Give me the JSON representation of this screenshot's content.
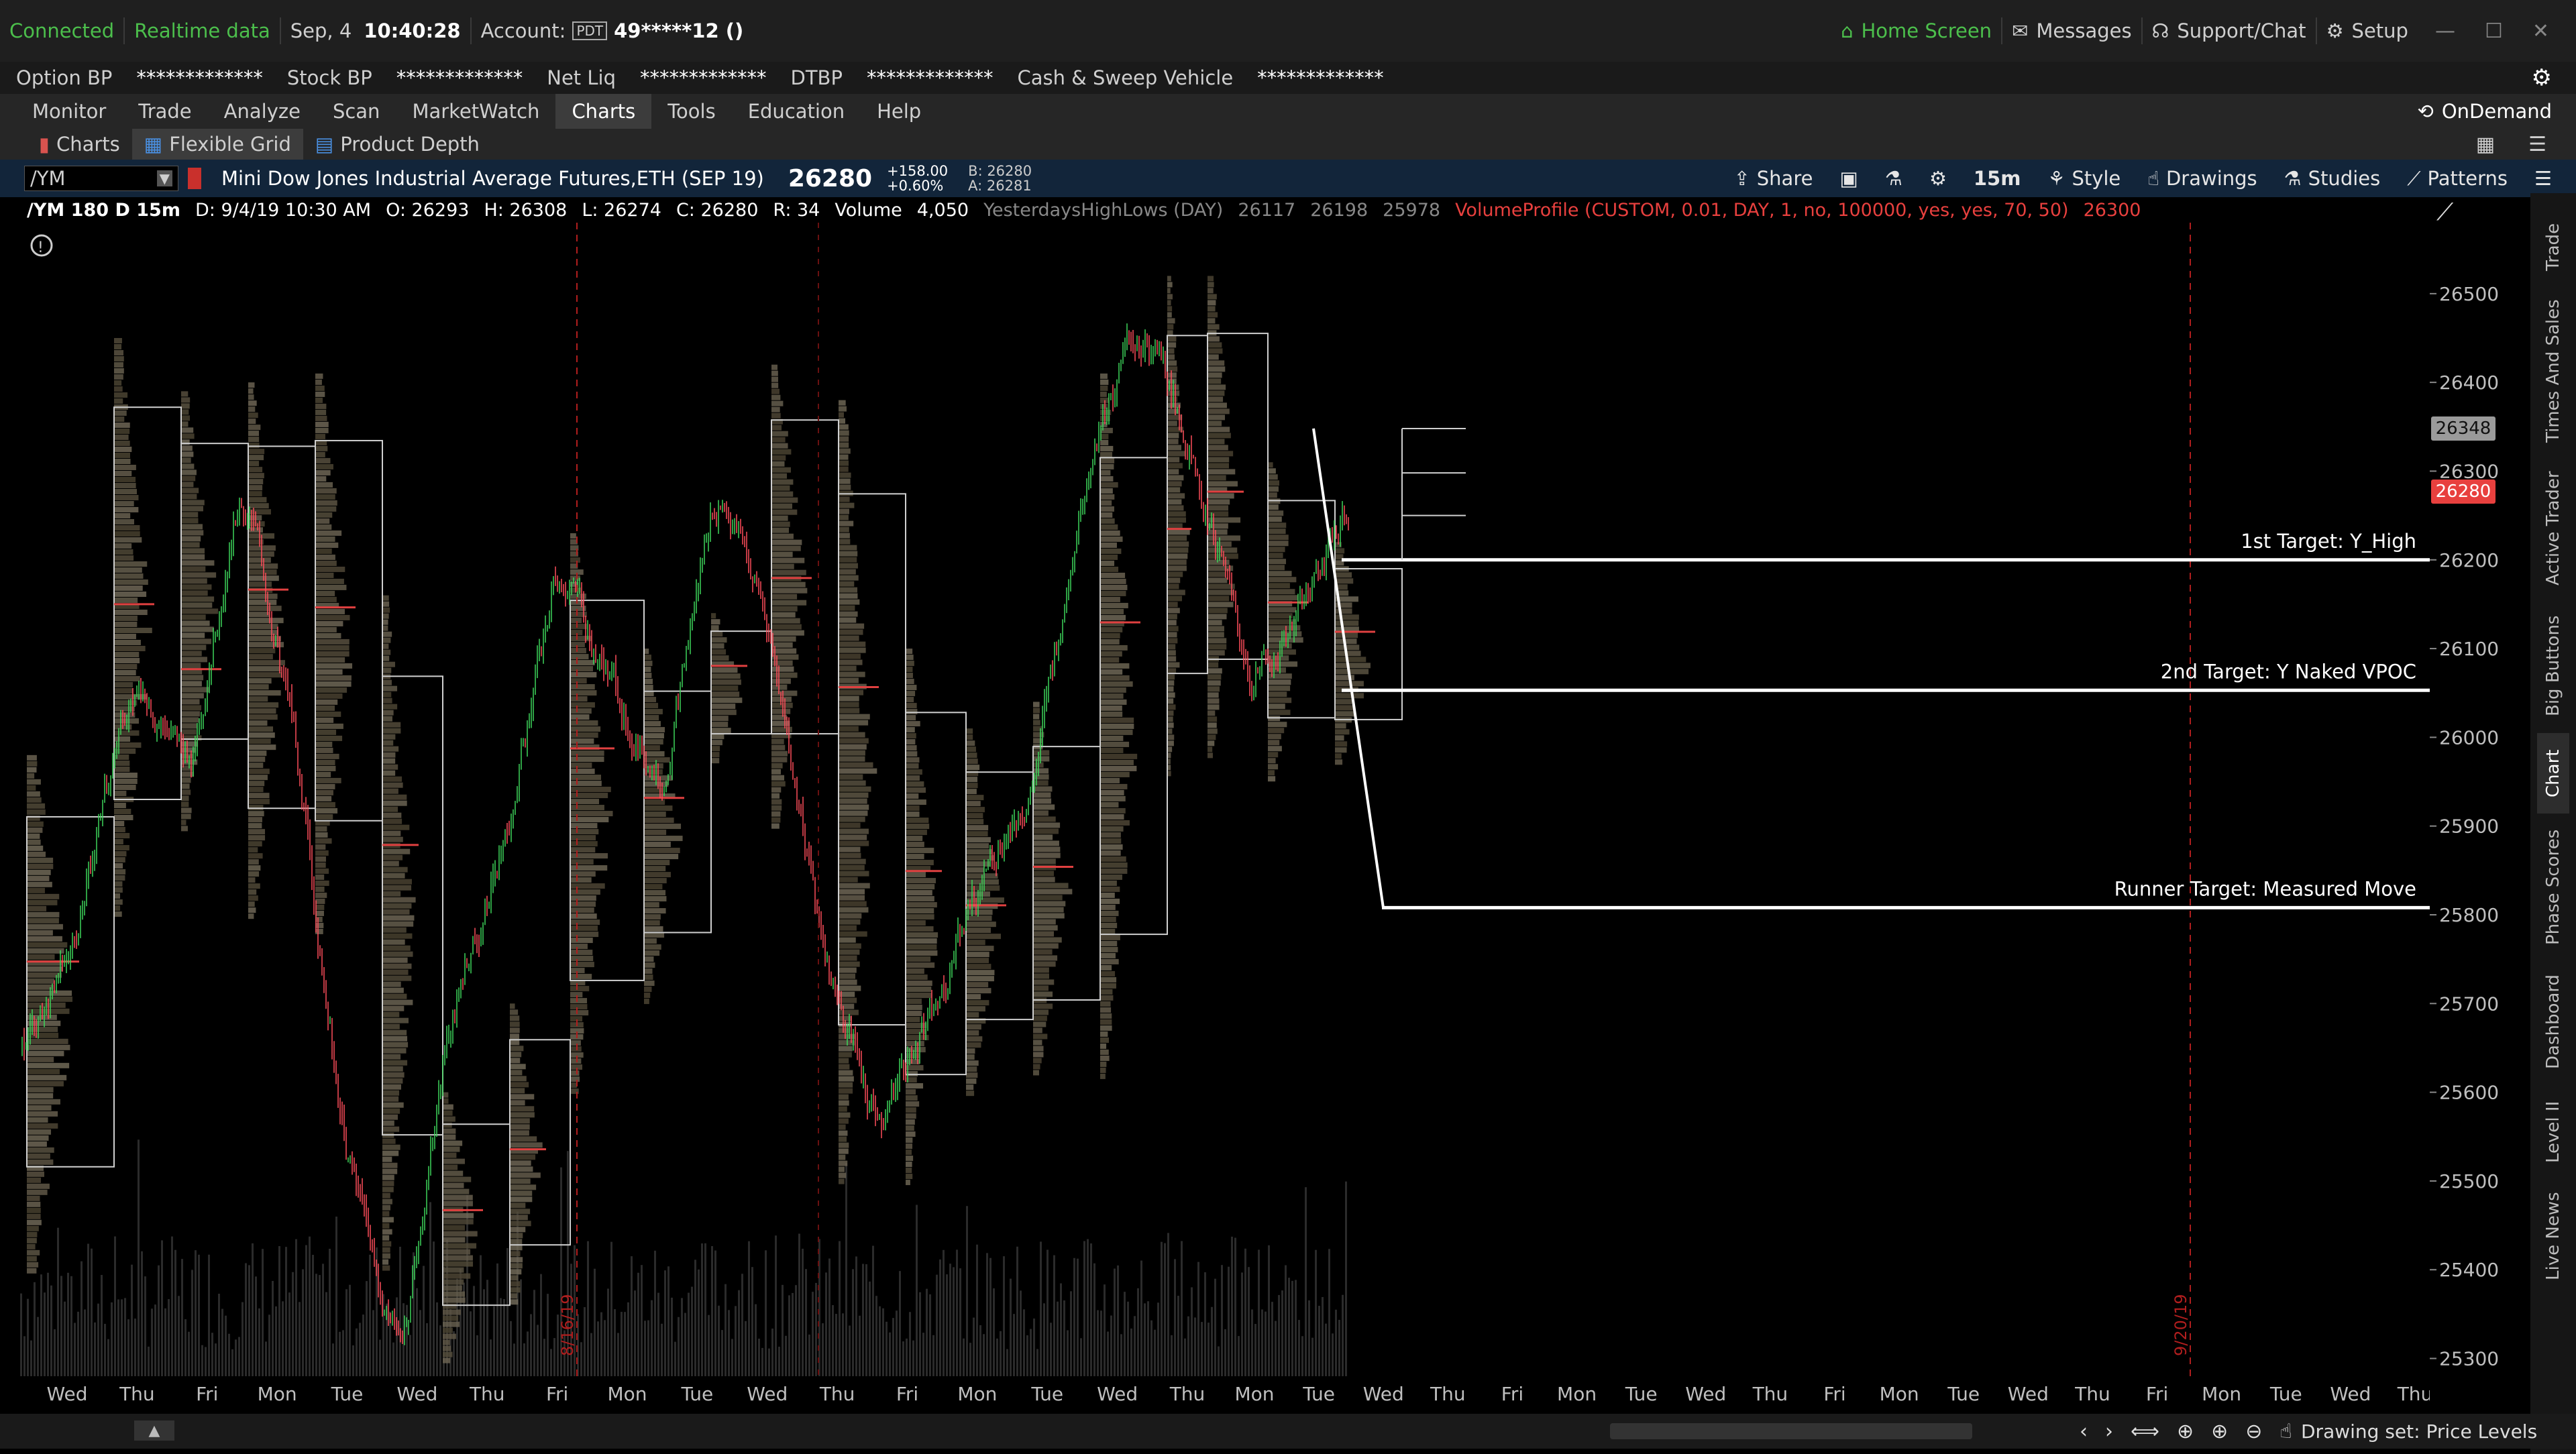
{
  "status": {
    "connected": "Connected",
    "realtime": "Realtime data",
    "date": "Sep, 4",
    "time": "10:40:28",
    "account_label": "Account:",
    "account_badge": "PDT",
    "account_id": "49*****12 ()",
    "home": "Home Screen",
    "messages": "Messages",
    "support": "Support/Chat",
    "setup": "Setup"
  },
  "balances": [
    {
      "label": "Option BP",
      "value": "*************"
    },
    {
      "label": "Stock BP",
      "value": "*************"
    },
    {
      "label": "Net Liq",
      "value": "*************"
    },
    {
      "label": "DTBP",
      "value": "*************"
    },
    {
      "label": "Cash & Sweep Vehicle",
      "value": "*************"
    }
  ],
  "menu": {
    "tabs": [
      "Monitor",
      "Trade",
      "Analyze",
      "Scan",
      "MarketWatch",
      "Charts",
      "Tools",
      "Education",
      "Help"
    ],
    "active": "Charts",
    "ondemand": "OnDemand"
  },
  "subtabs": [
    "Charts",
    "Flexible Grid",
    "Product Depth"
  ],
  "chart_header": {
    "symbol": "/YM",
    "description": "Mini Dow Jones Industrial Average Futures,ETH (SEP 19)",
    "last": "26280",
    "change": "+158.00",
    "change_pct": "+0.60%",
    "bid": "B: 26280",
    "ask": "A: 26281",
    "share": "Share",
    "timeframe": "15m",
    "style": "Style",
    "drawings": "Drawings",
    "studies": "Studies",
    "patterns": "Patterns"
  },
  "study_bar": {
    "period": "/YM 180 D 15m",
    "d": "D: 9/4/19 10:30 AM",
    "o": "O: 26293",
    "h": "H: 26308",
    "l": "L: 26274",
    "c": "C: 26280",
    "r": "R: 34",
    "vol_label": "Volume",
    "vol_value": "4,050",
    "yhl": "YesterdaysHighLows (DAY)",
    "yhl_values": [
      "26117",
      "26198",
      "25978"
    ],
    "vp": "VolumeProfile (CUSTOM, 0.01, DAY, 1, no, 100000, yes, yes, 70, 50)",
    "vp_value": "26300"
  },
  "chart_data": {
    "type": "candlestick",
    "y_ticks": [
      25300,
      25400,
      25500,
      25600,
      25700,
      25800,
      25900,
      26000,
      26100,
      26200,
      26300,
      26400,
      26500
    ],
    "ylim": [
      25280,
      26580
    ],
    "x_ticks": [
      "Wed",
      "Thu",
      "Fri",
      "Mon",
      "Tue",
      "Wed",
      "Thu",
      "Fri",
      "Mon",
      "Tue",
      "Wed",
      "Thu",
      "Fri",
      "Mon",
      "Tue",
      "Wed",
      "Thu",
      "Mon",
      "Tue",
      "Wed",
      "Thu",
      "Fri",
      "Mon",
      "Tue",
      "Wed",
      "Thu",
      "Fri",
      "Mon",
      "Tue",
      "Wed",
      "Thu",
      "Fri",
      "Mon",
      "Tue",
      "Wed",
      "Thu"
    ],
    "price_tags": {
      "high": "26348",
      "last": "26280"
    },
    "levels": [
      {
        "label": "1st Target: Y_High",
        "value": 26200
      },
      {
        "label": "2nd Target: Y Naked VPOC",
        "value": 26053
      },
      {
        "label": "Runner Target: Measured Move",
        "value": 25808
      }
    ],
    "date_markers": [
      "8/16/19",
      "9/20/19"
    ],
    "grid": false
  },
  "bottom": {
    "drawing_set": "Drawing set: Price Levels"
  },
  "right_rail": [
    "Trade",
    "Times And Sales",
    "Active Trader",
    "Big Buttons",
    "Chart",
    "Phase Scores",
    "Dashboard",
    "Level II",
    "Live News"
  ],
  "colors": {
    "up": "#3dd65a",
    "down": "#ff4d5a",
    "accent_green": "#4cbf4c",
    "header_bg": "#12253a"
  }
}
